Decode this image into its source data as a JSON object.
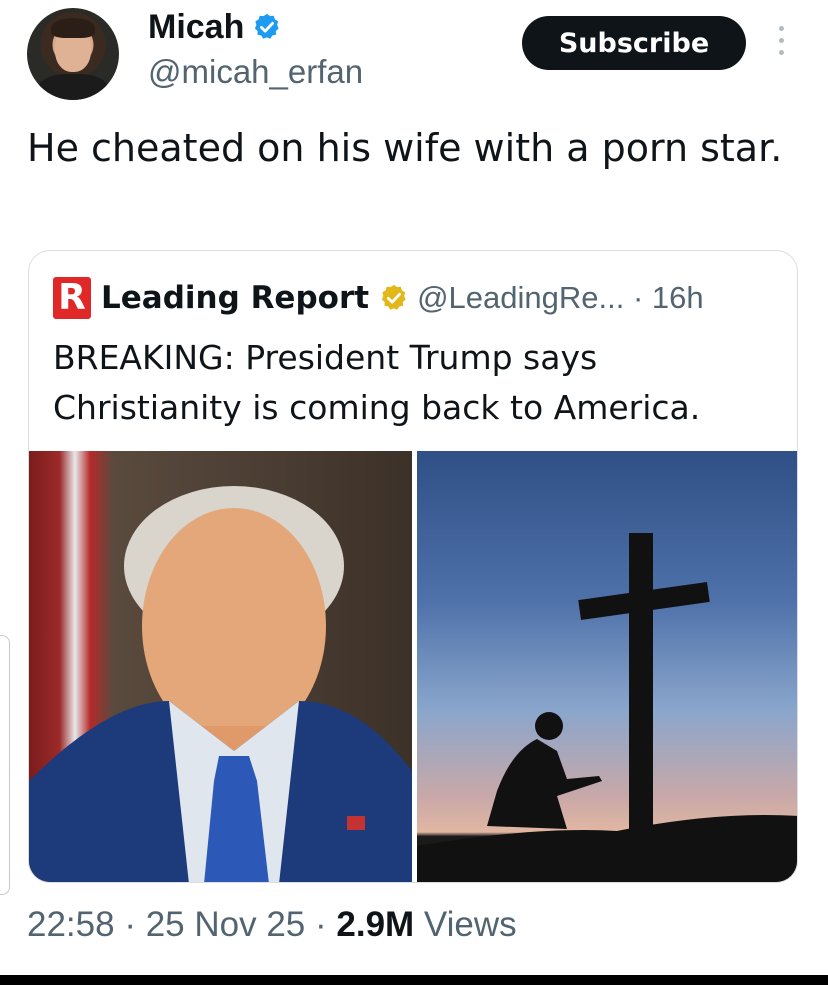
{
  "author": {
    "name": "Micah",
    "handle": "@micah_erfan",
    "verified": true
  },
  "actions": {
    "subscribe_label": "Subscribe",
    "more_icon": "more-vertical-icon"
  },
  "tweet": {
    "text": "He cheated on his wife with a porn star."
  },
  "quoted_tweet": {
    "logo_letter": "R",
    "account_name": "Leading Report",
    "handle": "@LeadingRe...",
    "separator": " · ",
    "time": "16h",
    "text": "BREAKING: President Trump says Christianity is coming back to America.",
    "images": [
      {
        "name": "portrait-photo"
      },
      {
        "name": "cross-prayer-photo"
      }
    ]
  },
  "meta": {
    "time": "22:58",
    "date": "25 Nov 25",
    "views_count": "2.9M",
    "views_label": "Views",
    "sep": " · "
  },
  "colors": {
    "verified_blue": "#1d9bf0",
    "gold_badge": "#e2b719",
    "logo_red": "#e02828",
    "text_primary": "#0f1419",
    "text_secondary": "#536471"
  }
}
